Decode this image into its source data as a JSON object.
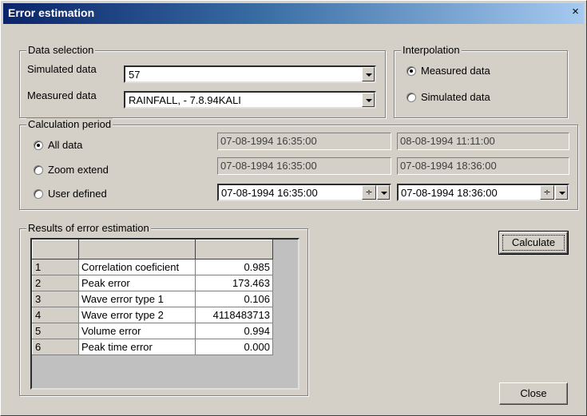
{
  "window": {
    "title": "Error estimation",
    "close_glyph": "×"
  },
  "data_selection": {
    "legend": "Data selection",
    "simulated_label": "Simulated data",
    "simulated_value": "57",
    "measured_label": "Measured data",
    "measured_value": "RAINFALL, - 7.8.94KALI"
  },
  "interpolation": {
    "legend": "Interpolation",
    "options": [
      "Measured data",
      "Simulated data"
    ],
    "selected": "Measured data"
  },
  "calculation_period": {
    "legend": "Calculation period",
    "options": [
      "All data",
      "Zoom extend",
      "User defined"
    ],
    "selected": "All data",
    "all_data_start": "07-08-1994 16:35:00",
    "all_data_end": "08-08-1994 11:11:00",
    "zoom_start": "07-08-1994 16:35:00",
    "zoom_end": "07-08-1994 18:36:00",
    "user_start": "07-08-1994 16:35:00",
    "user_end": "07-08-1994 18:36:00"
  },
  "results": {
    "legend": "Results of error estimation",
    "rows": [
      {
        "index": "1",
        "name": "Correlation coeficient",
        "value": "0.985"
      },
      {
        "index": "2",
        "name": "Peak error",
        "value": "173.463"
      },
      {
        "index": "3",
        "name": "Wave error type 1",
        "value": "0.106"
      },
      {
        "index": "4",
        "name": "Wave error type 2",
        "value": "4118483713"
      },
      {
        "index": "5",
        "name": "Volume error",
        "value": "0.994"
      },
      {
        "index": "6",
        "name": "Peak time error",
        "value": "0.000"
      }
    ]
  },
  "buttons": {
    "calculate": "Calculate",
    "close": "Close"
  },
  "icons": {
    "dropdown": "chevron-down-icon",
    "spin": "up-down-spin-icon",
    "close": "close-icon"
  }
}
